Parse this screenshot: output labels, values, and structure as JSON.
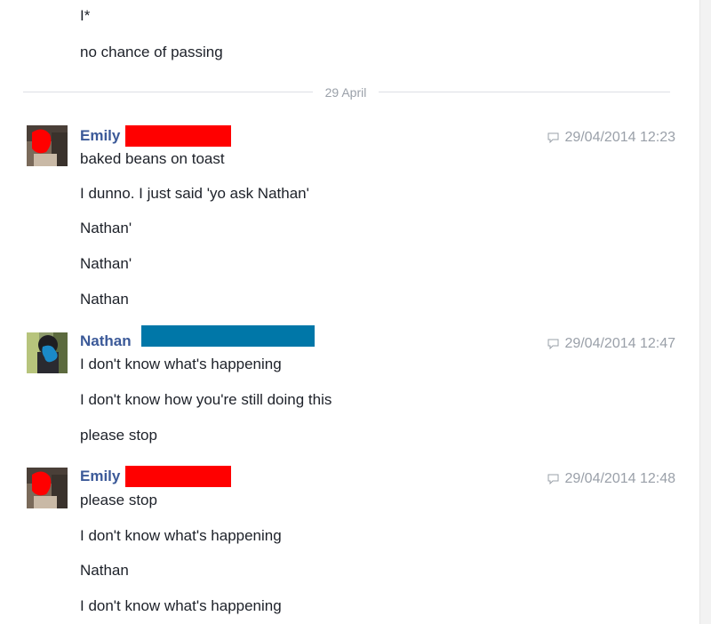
{
  "conversation": {
    "top_messages": [
      "I*",
      "no chance of passing"
    ],
    "date_divider": "29 April",
    "groups": [
      {
        "author": "Emily",
        "timestamp": "29/04/2014 12:23",
        "redaction_color": "#ff0000",
        "messages": [
          "baked beans on toast",
          "I dunno. I just said 'yo ask Nathan'",
          "Nathan'",
          "Nathan'",
          "Nathan"
        ]
      },
      {
        "author": "Nathan",
        "timestamp": "29/04/2014 12:47",
        "redaction_color": "#0077a8",
        "messages": [
          "I don't know what's happening",
          "I don't know how you're still doing this",
          "please stop"
        ]
      },
      {
        "author": "Emily",
        "timestamp": "29/04/2014 12:48",
        "redaction_color": "#ff0000",
        "messages": [
          "please stop",
          "I don't know what's happening",
          "Nathan",
          "I don't know what's happening"
        ]
      }
    ]
  },
  "colors": {
    "author_name": "#3b5998",
    "timestamp_text": "#9aa0a9",
    "divider": "#dcdfe4",
    "message_text": "#1d2129"
  },
  "icons": {
    "timestamp": "speech-bubble-icon"
  }
}
